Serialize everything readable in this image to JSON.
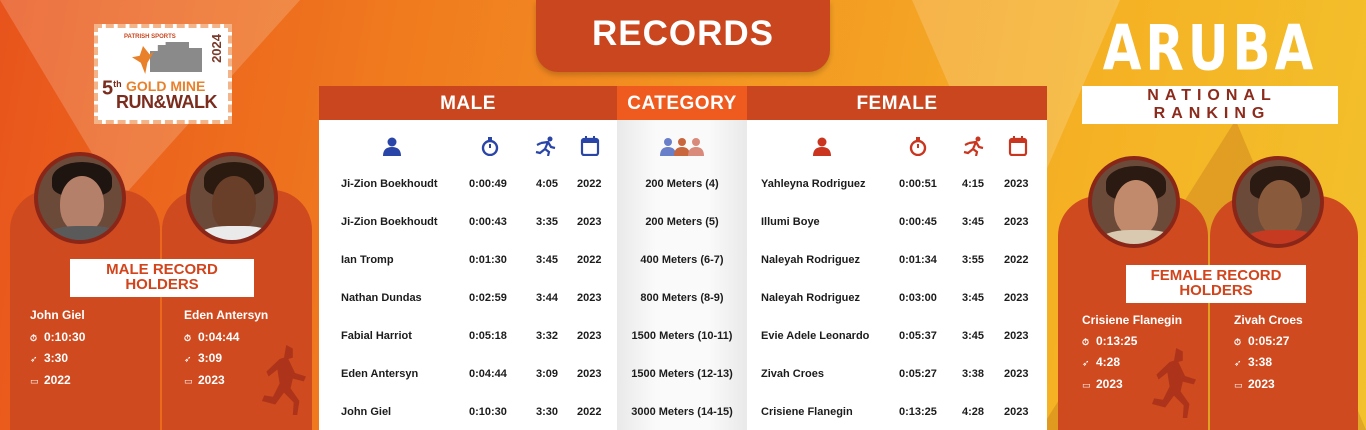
{
  "header": {
    "title": "RECORDS"
  },
  "logo": {
    "brand": "PATRISH SPORTS",
    "year": "2024",
    "edition": "5",
    "edition_suffix": "th",
    "line1": "GOLD MINE",
    "line2": "RUN&WALK"
  },
  "ranking": {
    "country": "ARUBA",
    "subtitle": "NATIONAL RANKING"
  },
  "table": {
    "headers": {
      "male": "MALE",
      "category": "CATEGORY",
      "female": "FEMALE"
    },
    "icons": {
      "athlete": "person-icon",
      "time": "stopwatch-icon",
      "pace": "runner-icon",
      "year": "calendar-icon",
      "category": "group-icon"
    },
    "rows": [
      {
        "male_name": "Ji-Zion Boekhoudt",
        "male_time": "0:00:49",
        "male_pace": "4:05",
        "male_year": "2022",
        "category": "200 Meters (4)",
        "female_name": "Yahleyna Rodriguez",
        "female_time": "0:00:51",
        "female_pace": "4:15",
        "female_year": "2023"
      },
      {
        "male_name": "Ji-Zion Boekhoudt",
        "male_time": "0:00:43",
        "male_pace": "3:35",
        "male_year": "2023",
        "category": "200 Meters (5)",
        "female_name": "Illumi Boye",
        "female_time": "0:00:45",
        "female_pace": "3:45",
        "female_year": "2023"
      },
      {
        "male_name": "Ian Tromp",
        "male_time": "0:01:30",
        "male_pace": "3:45",
        "male_year": "2022",
        "category": "400 Meters (6-7)",
        "female_name": "Naleyah Rodriguez",
        "female_time": "0:01:34",
        "female_pace": "3:55",
        "female_year": "2022"
      },
      {
        "male_name": "Nathan Dundas",
        "male_time": "0:02:59",
        "male_pace": "3:44",
        "male_year": "2023",
        "category": "800 Meters (8-9)",
        "female_name": "Naleyah Rodriguez",
        "female_time": "0:03:00",
        "female_pace": "3:45",
        "female_year": "2023"
      },
      {
        "male_name": "Fabial Harriot",
        "male_time": "0:05:18",
        "male_pace": "3:32",
        "male_year": "2023",
        "category": "1500 Meters (10-11)",
        "female_name": "Evie Adele Leonardo",
        "female_time": "0:05:37",
        "female_pace": "3:45",
        "female_year": "2023"
      },
      {
        "male_name": "Eden Antersyn",
        "male_time": "0:04:44",
        "male_pace": "3:09",
        "male_year": "2023",
        "category": "1500 Meters (12-13)",
        "female_name": "Zivah Croes",
        "female_time": "0:05:27",
        "female_pace": "3:38",
        "female_year": "2023"
      },
      {
        "male_name": "John Giel",
        "male_time": "0:10:30",
        "male_pace": "3:30",
        "male_year": "2022",
        "category": "3000 Meters (14-15)",
        "female_name": "Crisiene Flanegin",
        "female_time": "0:13:25",
        "female_pace": "4:28",
        "female_year": "2023"
      }
    ]
  },
  "male_holders": {
    "label": "MALE RECORD HOLDERS",
    "people": [
      {
        "name": "John Giel",
        "time": "0:10:30",
        "pace": "3:30",
        "year": "2022"
      },
      {
        "name": "Eden Antersyn",
        "time": "0:04:44",
        "pace": "3:09",
        "year": "2023"
      }
    ]
  },
  "female_holders": {
    "label": "FEMALE RECORD HOLDERS",
    "people": [
      {
        "name": "Crisiene Flanegin",
        "time": "0:13:25",
        "pace": "4:28",
        "year": "2023"
      },
      {
        "name": "Zivah Croes",
        "time": "0:05:27",
        "pace": "3:38",
        "year": "2023"
      }
    ]
  },
  "colors": {
    "accent": "#c9461e",
    "category": "#ef5a1e",
    "icon_male": "#2a45a8",
    "icon_female": "#c9351e"
  }
}
